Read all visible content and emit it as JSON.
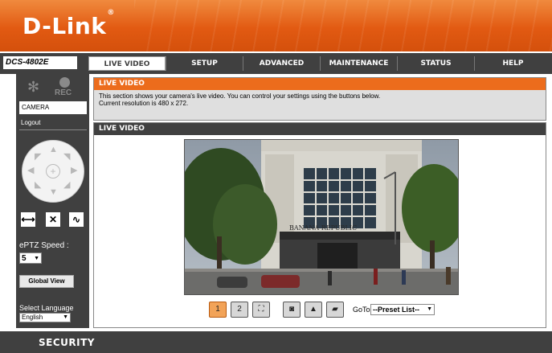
{
  "brand": {
    "logo": "D-Link",
    "trademark": "®"
  },
  "nav": {
    "model": "DCS-4802E",
    "tabs": [
      "LIVE VIDEO",
      "SETUP",
      "ADVANCED",
      "MAINTENANCE",
      "STATUS",
      "HELP"
    ],
    "active_tab": "LIVE VIDEO"
  },
  "sidebar": {
    "rec_label": "REC",
    "camera_field": "CAMERA",
    "logout": "Logout",
    "eptz_label": "ePTZ Speed :",
    "eptz_speed": "5",
    "global_view": "Global View",
    "language_label": "Select Language",
    "language_value": "English",
    "ptz_center": "+",
    "controls": [
      "horizontal-patrol-icon",
      "stop-icon",
      "path-patrol-icon"
    ]
  },
  "info_panel": {
    "title": "LIVE VIDEO",
    "line1": "This section shows your camera's live video. You can control your settings using the buttons below.",
    "line2": "Current resolution is 480 x 272."
  },
  "live_panel": {
    "title": "LIVE VIDEO",
    "video_sign": "BANANA REPUBLIC",
    "goto_label": "GoTo",
    "preset_value": "--Preset List--",
    "toolbar_icons": [
      "profile-1-icon",
      "profile-2-icon",
      "fullscreen-icon",
      "snapshot-icon",
      "record-icon",
      "folder-icon"
    ],
    "profile_1": "1",
    "profile_2": "2"
  },
  "footer": {
    "label": "SECURITY"
  },
  "colors": {
    "orange": "#ec6c1c",
    "dark": "#404040",
    "info_bg": "#dfdfdf"
  }
}
